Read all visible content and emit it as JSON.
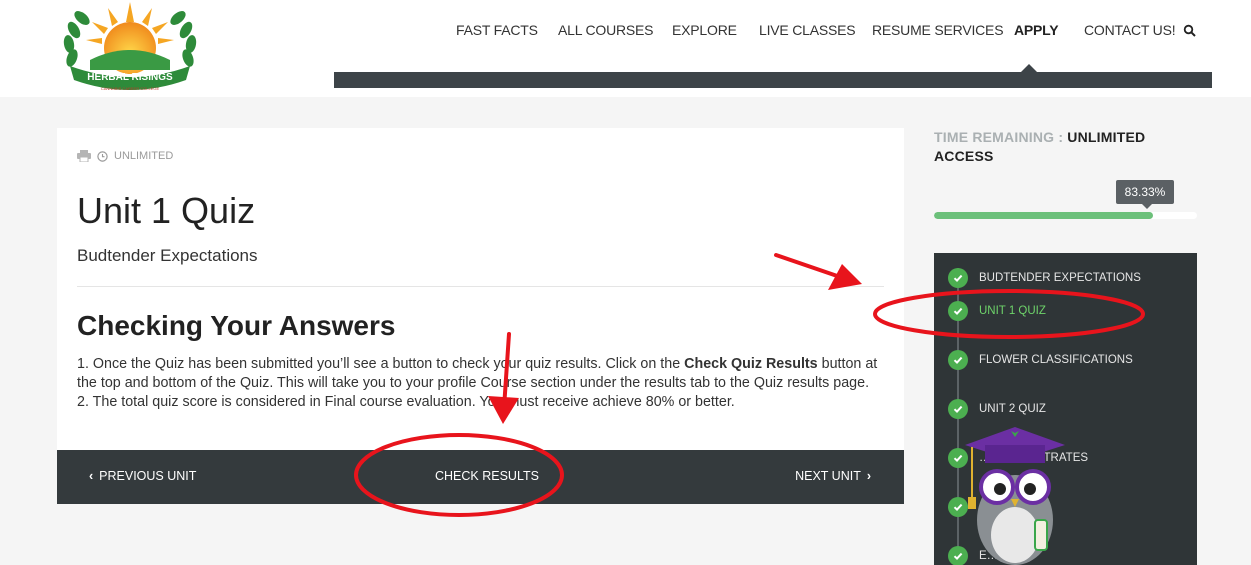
{
  "brand": {
    "logo_text": "HERBAL RISINGS",
    "logo_subtext": "CANNABIS CAREER COLLEGE"
  },
  "nav": {
    "items": [
      {
        "label": "FAST FACTS"
      },
      {
        "label": "ALL COURSES"
      },
      {
        "label": "EXPLORE"
      },
      {
        "label": "LIVE CLASSES"
      },
      {
        "label": "RESUME SERVICES"
      },
      {
        "label": "APPLY"
      },
      {
        "label": "CONTACT US!"
      }
    ],
    "active": "APPLY",
    "search_icon": "search-icon"
  },
  "quiz": {
    "access_label": "UNLIMITED",
    "title": "Unit 1 Quiz",
    "subtitle": "Budtender Expectations",
    "section_title": "Checking Your Answers",
    "para1_pre": "1. Once the Quiz has been submitted you’ll see a button to check your quiz results. Click on the ",
    "para1_bold": "Check Quiz Results",
    "para1_post": " button at the top and bottom of the Quiz. This will take you to your profile Course section under the results tab to the Quiz results page.",
    "para2": "2. The total quiz score is considered in Final course evaluation. You must receive achieve 80% or better."
  },
  "footer_nav": {
    "prev_label": "PREVIOUS UNIT",
    "check_label": "CHECK RESULTS",
    "next_label": "NEXT UNIT"
  },
  "sidebar": {
    "time_label": "TIME REMAINING : ",
    "time_value": "UNLIMITED ACCESS",
    "progress_label": "83.33%",
    "progress_value": 83.33,
    "units": [
      {
        "label": "BUDTENDER EXPECTATIONS",
        "current": false
      },
      {
        "label": "UNIT 1 QUIZ",
        "current": true
      },
      {
        "label": "FLOWER CLASSIFICATIONS",
        "current": false
      },
      {
        "label": "UNIT 2 QUIZ",
        "current": false
      },
      {
        "label": "… CONCENTRATES",
        "current": false
      },
      {
        "label": "",
        "current": false
      },
      {
        "label": "E…",
        "current": false
      }
    ]
  },
  "colors": {
    "accent_green": "#6cc07a",
    "dark_bar": "#343a3d",
    "annotation_red": "#e8141c"
  }
}
